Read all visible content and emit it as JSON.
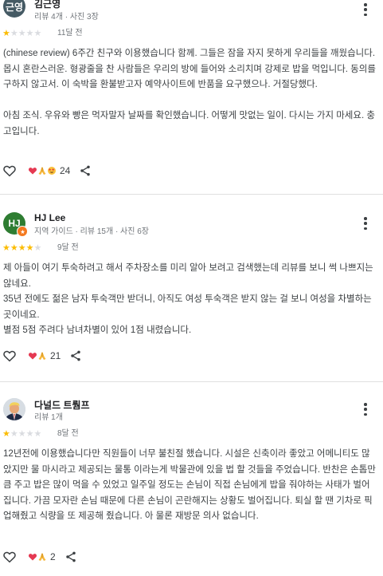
{
  "reviews": [
    {
      "avatar_text": "근영",
      "avatar_color": "#455a64",
      "name": "김근영",
      "meta": "리뷰 4개 · 사진 3장",
      "rating": 1,
      "time": "11달 전",
      "text": "(chinese review) 6주간 친구와 이용했습니다 함께. 그들은 잠을 자지 못하게 우리들을 깨웠습니다. 몹시 혼란스러운. 형광줄을 찬 사람들은 우리의 방에 들어와 소리치며 강제로 밥을 먹입니다. 동의를 구하지 않고서. 이 숙박을 환불받고자 예약사이트에 반품을 요구했으나. 거절당했다.\n\n아침 조식. 우유와 빵은 먹자말자 날짜를 확인했습니다. 어떻게 맛없는 일이. 다시는 가지 마세요. 충고입니다.",
      "reaction_emojis": [
        "heart-emoji",
        "pray-emoji",
        "starstruck-emoji"
      ],
      "reaction_count": "24"
    },
    {
      "avatar_text": "HJ",
      "avatar_color": "#2e7d32",
      "name": "HJ Lee",
      "meta": "지역 가이드 · 리뷰 15개 · 사진 6장",
      "rating": 4,
      "time": "9달 전",
      "text": "제 아들이 여기 투숙하려고 해서 주차장소를 미리 알아 보려고 검색했는데 리뷰를 보니 썩 나쁘지는 않네요.\n35년 전에도 젊은 남자 투숙객만 받더니, 아직도 여성 투숙객은 받지 않는 걸 보니 여성을 차별하는 곳이네요.\n별점 5점 주려다 남녀차별이 있어 1점 내렸습니다.",
      "reaction_emojis": [
        "heart-emoji",
        "pray-emoji"
      ],
      "reaction_count": "21"
    },
    {
      "avatar_text": "",
      "avatar_color": "#8a6a52",
      "name": "다널드 트뤔프",
      "meta": "리뷰 1개",
      "rating": 1,
      "time": "8달 전",
      "text": "12년전에 이용했습니다만 직원들이 너무 불친절 했습니다. 시설은 신축이라 좋았고 어메니티도 많았지만 물 마시라고 제공되는 물통 이라는게 박물관에 있을 법 할 것들을 주었습니다. 반찬은 손톱만큼 주고 밥은 많이 먹을 수 있었고 일주일 정도는 손님이 직접 손님에게 밥을 줘야하는 사태가 벌어집니다. 가끔 모자란 손님 때문에 다른 손님이 곤란해지는 상황도 벌어집니다. 퇴실 할 땐 기차로 픽업해줬고 식량을 또 제공해 줬습니다. 아 물론 재방문 의사 없습니다.",
      "reaction_emojis": [
        "heart-emoji",
        "pray-emoji"
      ],
      "reaction_count": "2"
    }
  ]
}
